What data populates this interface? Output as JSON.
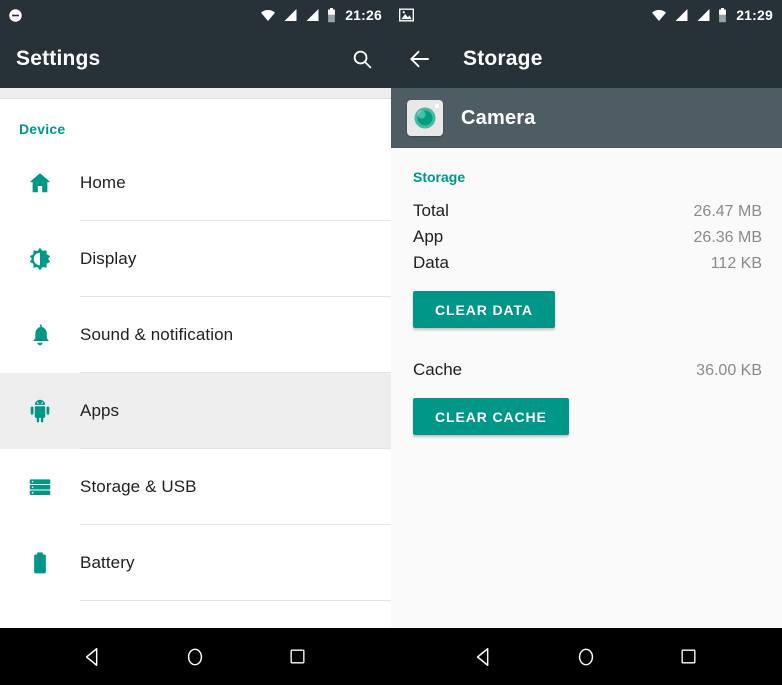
{
  "left": {
    "status_bar": {
      "time": "21:26",
      "icons": [
        "do-not-disturb-icon",
        "wifi-icon",
        "signal-icon",
        "signal-icon",
        "battery-icon"
      ]
    },
    "toolbar": {
      "title": "Settings",
      "search_icon": "search-icon"
    },
    "section_header": "Device",
    "items": [
      {
        "label": "Home",
        "icon": "home-icon",
        "selected": false
      },
      {
        "label": "Display",
        "icon": "brightness-icon",
        "selected": false
      },
      {
        "label": "Sound & notification",
        "icon": "bell-icon",
        "selected": false
      },
      {
        "label": "Apps",
        "icon": "android-icon",
        "selected": true
      },
      {
        "label": "Storage & USB",
        "icon": "storage-icon",
        "selected": false
      },
      {
        "label": "Battery",
        "icon": "battery-icon",
        "selected": false
      }
    ],
    "nav_bar": [
      "back-icon",
      "home-icon",
      "recents-icon"
    ]
  },
  "right": {
    "status_bar": {
      "time": "21:29",
      "icons": [
        "screenshot-icon",
        "wifi-icon",
        "signal-icon",
        "signal-icon",
        "battery-icon"
      ]
    },
    "toolbar": {
      "title": "Storage",
      "back_icon": "back-arrow-icon"
    },
    "app": {
      "name": "Camera",
      "icon": "camera-app-icon"
    },
    "section_title": "Storage",
    "rows": [
      {
        "key": "Total",
        "value": "26.47 MB"
      },
      {
        "key": "App",
        "value": "26.36 MB"
      },
      {
        "key": "Data",
        "value": "112 KB"
      }
    ],
    "clear_data_label": "CLEAR DATA",
    "cache": {
      "key": "Cache",
      "value": "36.00 KB"
    },
    "clear_cache_label": "CLEAR CACHE",
    "nav_bar": [
      "back-icon",
      "home-icon",
      "recents-icon"
    ]
  },
  "colors": {
    "accent": "#009688",
    "toolbar": "#263238",
    "app_header": "#4e5d64",
    "selected_row": "#eeeeee",
    "value_text": "#8a8a8a"
  }
}
